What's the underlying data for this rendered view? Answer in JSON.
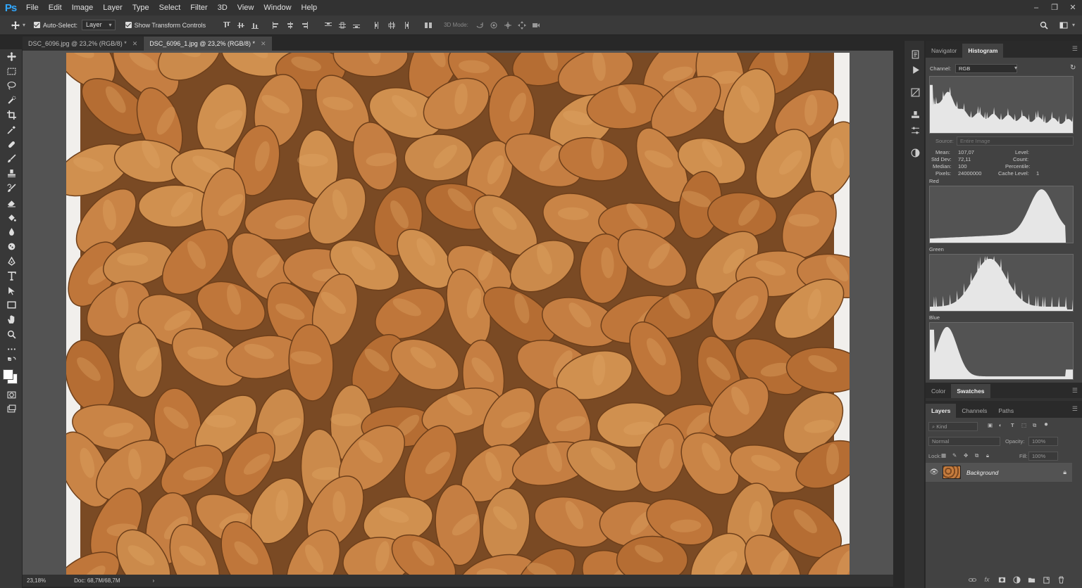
{
  "app": {
    "logo": "Ps"
  },
  "menu": [
    "File",
    "Edit",
    "Image",
    "Layer",
    "Type",
    "Select",
    "Filter",
    "3D",
    "View",
    "Window",
    "Help"
  ],
  "window_controls": [
    "–",
    "❐",
    "✕"
  ],
  "options": {
    "auto_select_label": "Auto-Select:",
    "auto_select_value": "Layer",
    "transform_label": "Show Transform Controls",
    "mode3d_label": "3D Mode:"
  },
  "tabs": [
    {
      "label": "DSC_6096.jpg @ 23,2% (RGB/8) *",
      "active": false
    },
    {
      "label": "DSC_6096_1.jpg @ 23,2% (RGB/8) *",
      "active": true
    }
  ],
  "status": {
    "zoom": "23,18%",
    "doc": "Doc: 68,7M/68,7M",
    "arrow": "›"
  },
  "panels": {
    "top_tabs": [
      "Navigator",
      "Histogram"
    ],
    "histogram": {
      "channel_label": "Channel:",
      "channel_value": "RGB",
      "source_label": "Source:",
      "source_value": "Entire Image",
      "stats": {
        "mean_label": "Mean:",
        "mean": "107,07",
        "stddev_label": "Std Dev:",
        "stddev": "72,11",
        "median_label": "Median:",
        "median": "100",
        "pixels_label": "Pixels:",
        "pixels": "24000000",
        "level_label": "Level:",
        "count_label": "Count:",
        "percentile_label": "Percentile:",
        "cache_label": "Cache Level:",
        "cache": "1"
      },
      "red_label": "Red",
      "green_label": "Green",
      "blue_label": "Blue"
    },
    "mid_tabs": [
      "Color",
      "Swatches"
    ],
    "layer_tabs": [
      "Layers",
      "Channels",
      "Paths"
    ],
    "layers": {
      "kind_placeholder": "Kind",
      "blend_mode": "Normal",
      "opacity_label": "Opacity:",
      "opacity": "100%",
      "lock_label": "Lock:",
      "fill_label": "Fill:",
      "fill": "100%",
      "layer_name": "Background"
    }
  },
  "colors": {
    "accent": "#31a8ff",
    "bg": "#282828",
    "panel": "#424242"
  }
}
